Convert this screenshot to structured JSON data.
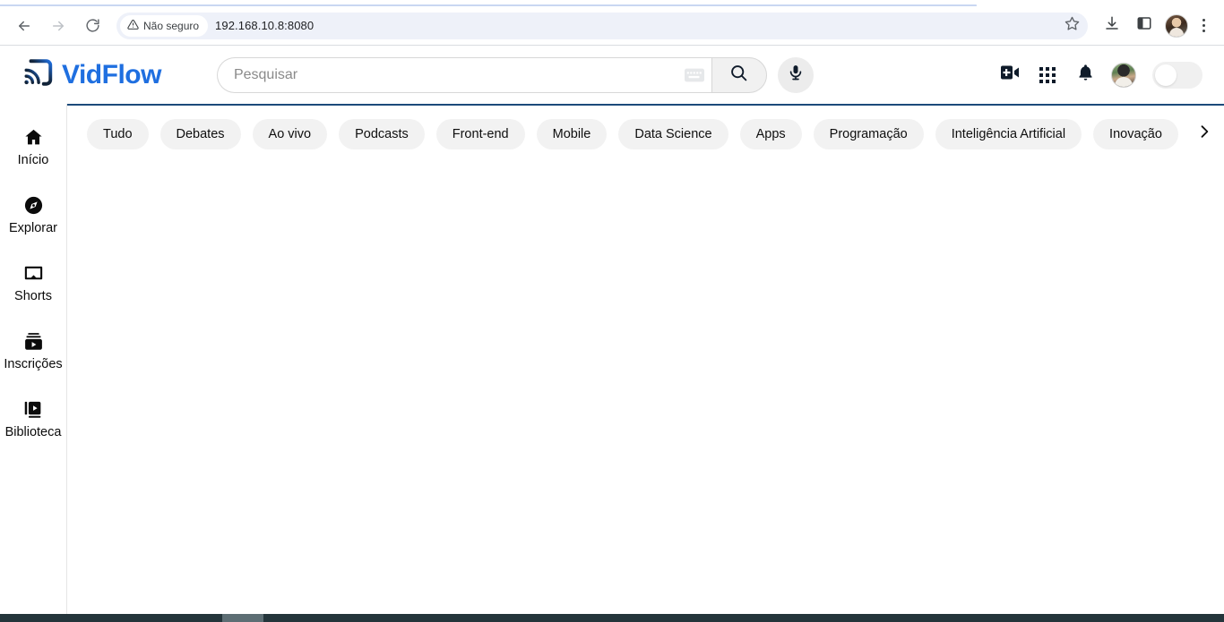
{
  "browser": {
    "back_icon": "back-arrow-icon",
    "forward_icon": "forward-arrow-icon",
    "reload_icon": "reload-icon",
    "security_label": "Não seguro",
    "security_icon": "warning-triangle-icon",
    "url": "192.168.10.8:8080",
    "star_icon": "bookmark-star-icon",
    "download_icon": "download-icon",
    "sidepanel_icon": "side-panel-icon",
    "profile_icon": "profile-avatar-icon",
    "menu_icon": "three-dot-menu-icon"
  },
  "header": {
    "logo_text": "VidFlow",
    "logo_icon": "cast-stream-icon",
    "logo_color": "#1f6fe0",
    "search": {
      "placeholder": "Pesquisar",
      "value": "",
      "keyboard_icon": "keyboard-icon",
      "submit_icon": "search-icon",
      "mic_icon": "microphone-icon"
    },
    "actions": {
      "create_icon": "create-video-icon",
      "apps_icon": "apps-grid-icon",
      "notifications_icon": "bell-icon",
      "avatar_icon": "user-avatar",
      "theme_toggle_state": "off"
    }
  },
  "sidebar": {
    "items": [
      {
        "label": "Início",
        "icon": "home-icon"
      },
      {
        "label": "Explorar",
        "icon": "compass-icon"
      },
      {
        "label": "Shorts",
        "icon": "shorts-screen-icon"
      },
      {
        "label": "Inscrições",
        "icon": "subscriptions-icon"
      },
      {
        "label": "Biblioteca",
        "icon": "library-icon"
      }
    ]
  },
  "chips": {
    "items": [
      {
        "label": "Tudo"
      },
      {
        "label": "Debates"
      },
      {
        "label": "Ao vivo"
      },
      {
        "label": "Podcasts"
      },
      {
        "label": "Front-end"
      },
      {
        "label": "Mobile"
      },
      {
        "label": "Data Science"
      },
      {
        "label": "Apps"
      },
      {
        "label": "Programação"
      },
      {
        "label": "Inteligência Artificial"
      },
      {
        "label": "Inovação"
      }
    ],
    "scroll_right_icon": "chevron-right-icon"
  },
  "content": {
    "empty": ""
  }
}
